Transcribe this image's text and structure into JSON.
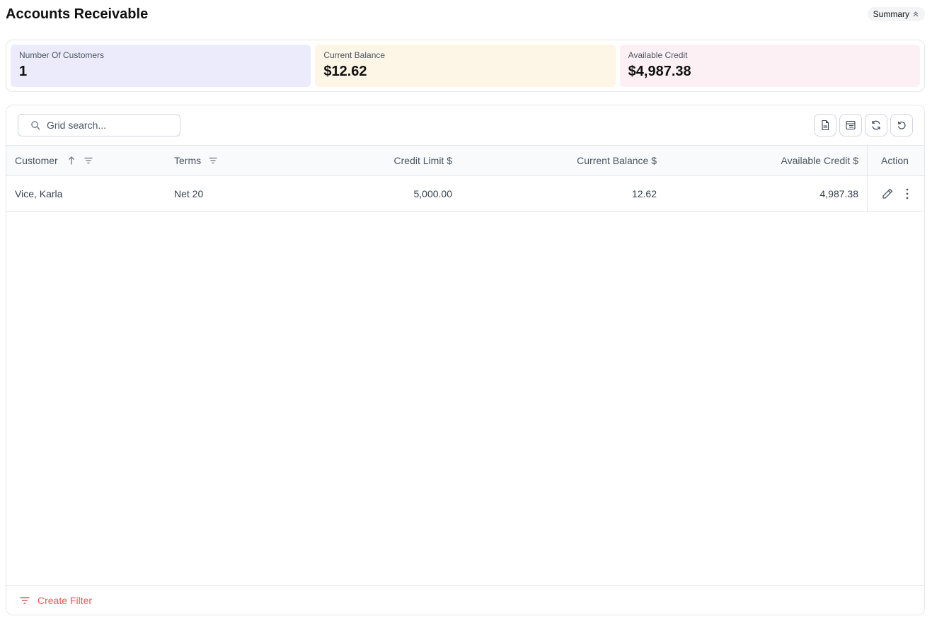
{
  "page": {
    "title": "Accounts Receivable"
  },
  "summary_toggle": {
    "label": "Summary",
    "icon": "chevron-up-icon"
  },
  "cards": [
    {
      "label": "Number Of Customers",
      "value": "1",
      "color": "#ecebfc"
    },
    {
      "label": "Current Balance",
      "value": "$12.62",
      "color": "#fdf6e6"
    },
    {
      "label": "Available Credit",
      "value": "$4,987.38",
      "color": "#fdf0f5"
    }
  ],
  "search": {
    "placeholder": "Grid search..."
  },
  "toolbar": {
    "icons": [
      "export-xlsx-icon",
      "columns-icon",
      "refresh-icon",
      "reset-icon"
    ]
  },
  "table": {
    "columns": {
      "customer": "Customer",
      "terms": "Terms",
      "credit_limit": "Credit Limit $",
      "current_balance": "Current Balance $",
      "available_credit": "Available Credit $",
      "action": "Action"
    },
    "rows": [
      {
        "customer": "Vice, Karla",
        "terms": "Net 20",
        "credit_limit": "5,000.00",
        "current_balance": "12.62",
        "available_credit": "4,987.38"
      }
    ]
  },
  "footer": {
    "create_filter": "Create Filter",
    "accent": "#e15b5b"
  }
}
